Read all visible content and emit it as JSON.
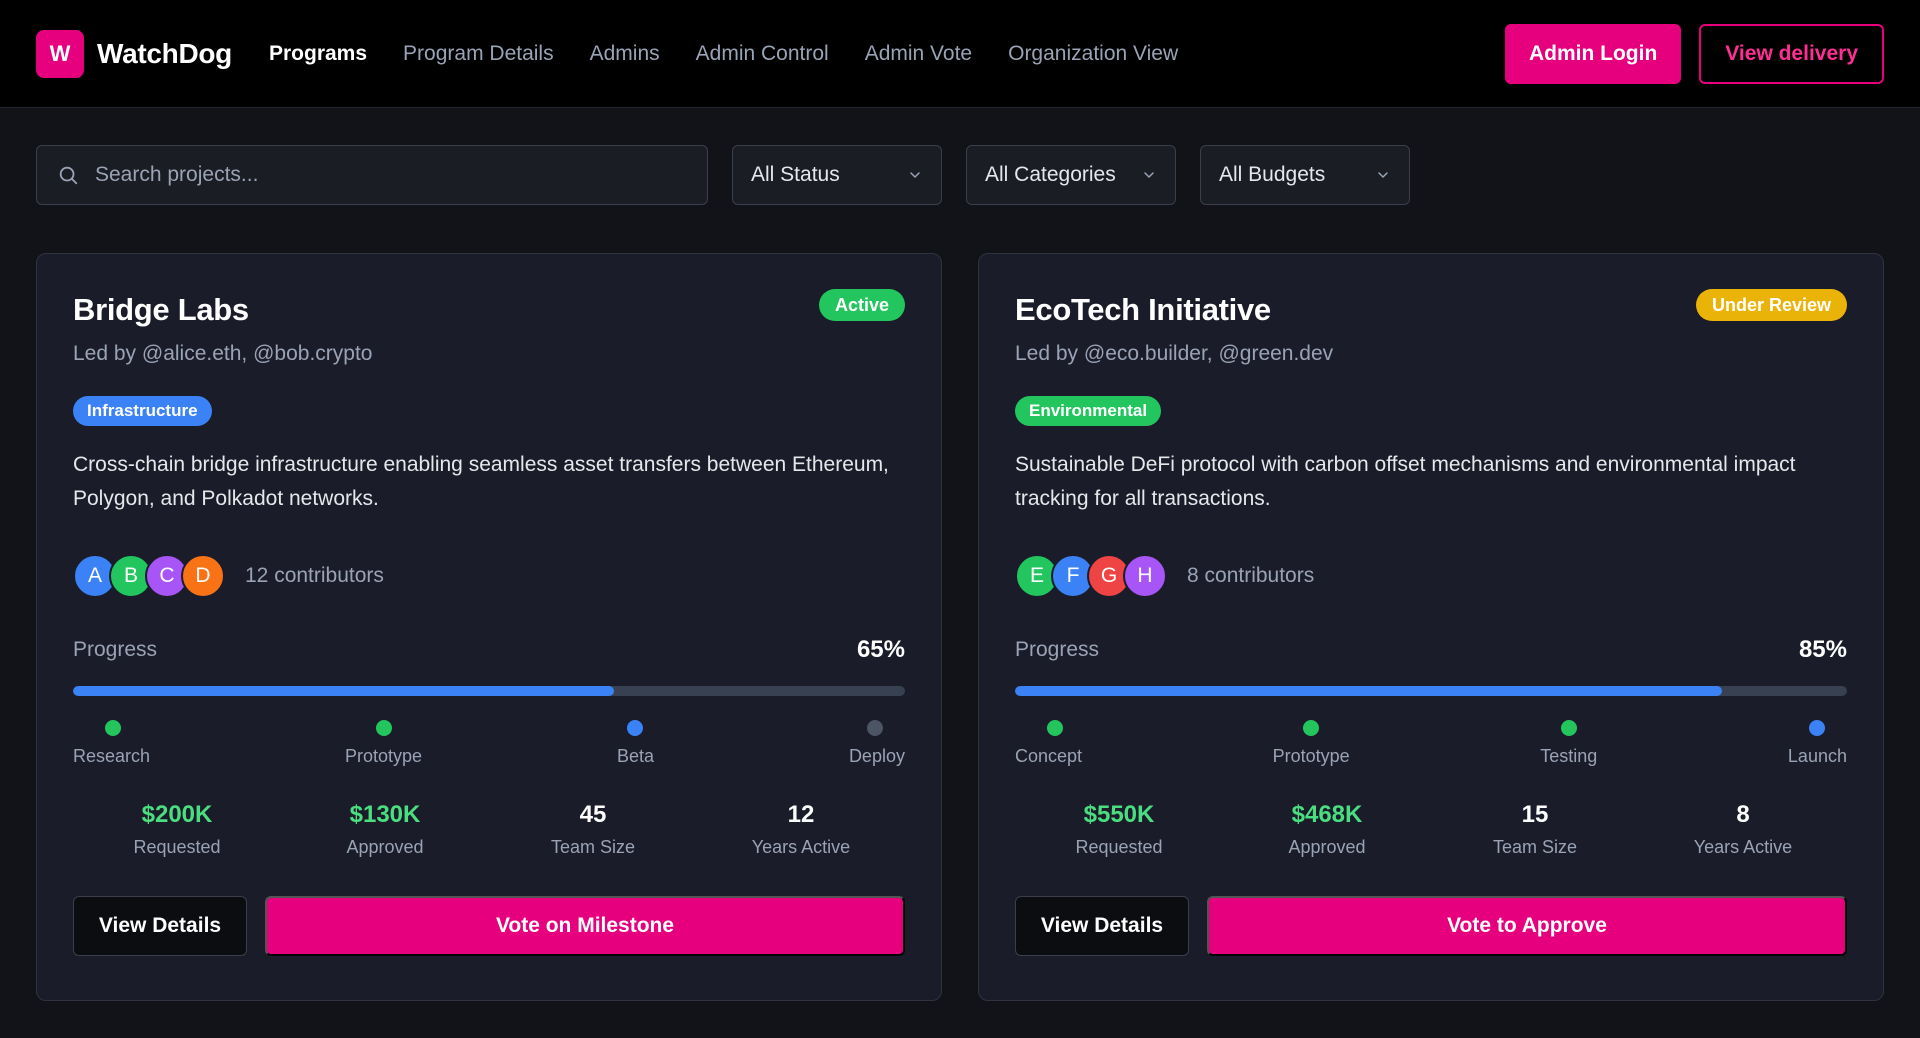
{
  "header": {
    "logo_letter": "W",
    "brand": "WatchDog",
    "nav": [
      "Programs",
      "Program Details",
      "Admins",
      "Admin Control",
      "Admin Vote",
      "Organization View"
    ],
    "active_nav": "Programs",
    "login_label": "Admin Login",
    "delivery_label": "View delivery"
  },
  "filters": {
    "search_placeholder": "Search projects...",
    "status": "All Status",
    "categories": "All Categories",
    "budgets": "All Budgets"
  },
  "colors": {
    "accent": "#e6007e",
    "progress_blue": "#3b82f6",
    "stat_green": "#4ade80",
    "active_green": "#22c55e",
    "review_yellow": "#eab308",
    "infrastructure_blue": "#3b82f6",
    "environmental_green": "#22c55e"
  },
  "cards": [
    {
      "title": "Bridge Labs",
      "status": "Active",
      "lead": "Led by @alice.eth, @bob.crypto",
      "category": "Infrastructure",
      "description": "Cross-chain bridge infrastructure enabling seamless asset transfers between Ethereum, Polygon, and Polkadot networks.",
      "avatars": [
        {
          "letter": "A",
          "color": "#3b82f6"
        },
        {
          "letter": "B",
          "color": "#22c55e"
        },
        {
          "letter": "C",
          "color": "#a855f7"
        },
        {
          "letter": "D",
          "color": "#f97316"
        }
      ],
      "contributors": "12 contributors",
      "progress_label": "Progress",
      "progress_text": "65%",
      "progress_value": 0.65,
      "milestones": [
        {
          "label": "Research",
          "state": "done"
        },
        {
          "label": "Prototype",
          "state": "done"
        },
        {
          "label": "Beta",
          "state": "current"
        },
        {
          "label": "Deploy",
          "state": "pending"
        }
      ],
      "stats": [
        {
          "value": "$200K",
          "label": "Requested",
          "tone": "green"
        },
        {
          "value": "$130K",
          "label": "Approved",
          "tone": "green"
        },
        {
          "value": "45",
          "label": "Team Size",
          "tone": "white"
        },
        {
          "value": "12",
          "label": "Years Active",
          "tone": "white"
        }
      ],
      "details_label": "View Details",
      "vote_label": "Vote on Milestone"
    },
    {
      "title": "EcoTech Initiative",
      "status": "Under Review",
      "lead": "Led by @eco.builder, @green.dev",
      "category": "Environmental",
      "description": "Sustainable DeFi protocol with carbon offset mechanisms and environmental impact tracking for all transactions.",
      "avatars": [
        {
          "letter": "E",
          "color": "#22c55e"
        },
        {
          "letter": "F",
          "color": "#3b82f6"
        },
        {
          "letter": "G",
          "color": "#ef4444"
        },
        {
          "letter": "H",
          "color": "#a855f7"
        }
      ],
      "contributors": "8 contributors",
      "progress_label": "Progress",
      "progress_text": "85%",
      "progress_value": 0.85,
      "milestones": [
        {
          "label": "Concept",
          "state": "done"
        },
        {
          "label": "Prototype",
          "state": "done"
        },
        {
          "label": "Testing",
          "state": "done"
        },
        {
          "label": "Launch",
          "state": "current"
        }
      ],
      "stats": [
        {
          "value": "$550K",
          "label": "Requested",
          "tone": "green"
        },
        {
          "value": "$468K",
          "label": "Approved",
          "tone": "green"
        },
        {
          "value": "15",
          "label": "Team Size",
          "tone": "white"
        },
        {
          "value": "8",
          "label": "Years Active",
          "tone": "white"
        }
      ],
      "details_label": "View Details",
      "vote_label": "Vote to Approve"
    }
  ]
}
